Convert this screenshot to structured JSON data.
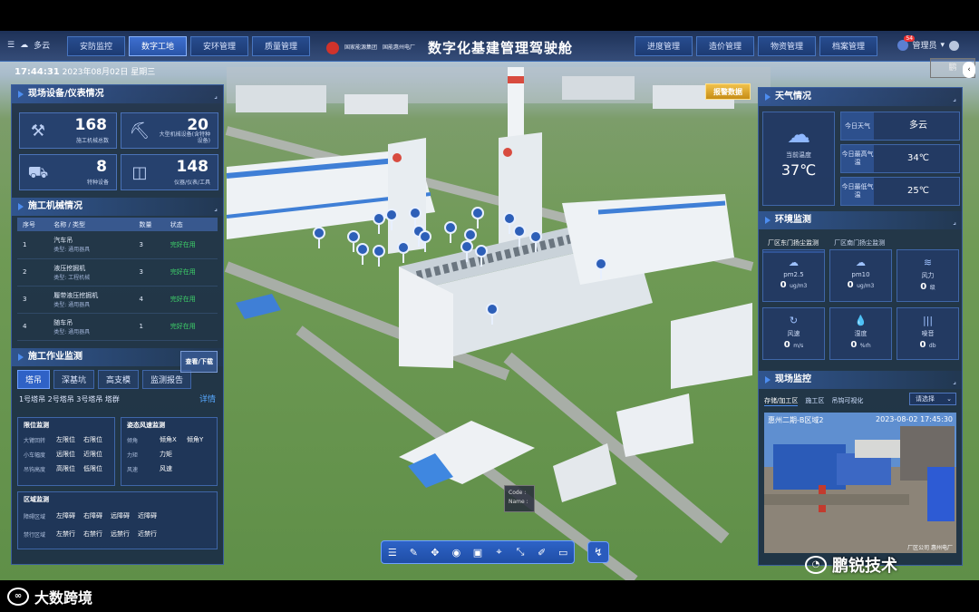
{
  "header": {
    "weather_text": "多云",
    "title": "数字化基建管理驾驶舱",
    "org_line1": "国家能源集团",
    "org_line2": "国能惠州电厂",
    "time": "17:44:31",
    "date": "2023年08月02日 星期三",
    "user": "管理员",
    "notif_count": "54",
    "left_tabs": [
      "安防监控",
      "数字工地",
      "安环管理",
      "质量管理"
    ],
    "right_tabs": [
      "进度管理",
      "造价管理",
      "物资管理",
      "档案管理"
    ],
    "active_tab": "数字工地",
    "side_label": "鹏",
    "side_arrow": "‹"
  },
  "equipment": {
    "title": "现场设备/仪表情况",
    "stats": [
      {
        "value": "168",
        "label": "施工机械总数",
        "icon": "crane-icon"
      },
      {
        "value": "20",
        "label": "大型机械设备(含特种设备)",
        "icon": "excavator-icon"
      },
      {
        "value": "8",
        "label": "特种设备",
        "icon": "truck-icon"
      },
      {
        "value": "148",
        "label": "仪器/仪表/工具",
        "icon": "gauge-icon"
      }
    ]
  },
  "machinery": {
    "title": "施工机械情况",
    "headers": [
      "序号",
      "名称 / 类型",
      "数量",
      "状态"
    ],
    "rows": [
      {
        "no": "1",
        "name": "汽车吊",
        "type": "类型: 通用器具",
        "qty": "3",
        "status": "完好在用"
      },
      {
        "no": "2",
        "name": "液压挖掘机",
        "type": "类型: 工程机械",
        "qty": "3",
        "status": "完好在用"
      },
      {
        "no": "3",
        "name": "履带液压挖掘机",
        "type": "类型: 通用器具",
        "qty": "4",
        "status": "完好在用"
      },
      {
        "no": "4",
        "name": "随车吊",
        "type": "类型: 通用器具",
        "qty": "1",
        "status": "完好在用"
      }
    ]
  },
  "monitor": {
    "title": "施工作业监测",
    "view_btn": "查看/下载",
    "tabs": [
      "塔吊",
      "深基坑",
      "高支模",
      "监测报告"
    ],
    "crane_list": "1号塔吊  2号塔吊  3号塔吊    塔群",
    "detail": "详情",
    "limit": {
      "title": "限位监测",
      "rows": [
        [
          "大臂回转",
          "左限位",
          "右限位"
        ],
        [
          "小车幅度",
          "远限位",
          "近限位"
        ],
        [
          "吊钩高度",
          "高限位",
          "低限位"
        ]
      ]
    },
    "posture": {
      "title": "姿态风速监测",
      "rows": [
        [
          "倾角",
          "倾角X",
          "倾角Y"
        ],
        [
          "力矩",
          "力矩",
          ""
        ],
        [
          "风速",
          "风速",
          ""
        ]
      ]
    },
    "zone": {
      "title": "区域监测",
      "rows": [
        [
          "障碍区域",
          "左障碍",
          "右障碍",
          "远障碍",
          "近障碍"
        ],
        [
          "禁行区域",
          "左禁行",
          "右禁行",
          "远禁行",
          "近禁行"
        ]
      ]
    }
  },
  "weather": {
    "title": "天气情况",
    "current_label": "当前温度",
    "current_temp": "37℃",
    "rows": [
      {
        "k": "今日天气",
        "v": "多云"
      },
      {
        "k": "今日最高气温",
        "v": "34℃"
      },
      {
        "k": "今日最低气温",
        "v": "25℃"
      }
    ]
  },
  "env": {
    "title": "环境监测",
    "tabs": [
      "厂区东门扬尘监测",
      "厂区南门扬尘监测"
    ],
    "cells": [
      {
        "k": "pm2.5",
        "v": "0",
        "u": "ug/m3",
        "icon": "pm25-icon"
      },
      {
        "k": "pm10",
        "v": "0",
        "u": "ug/m3",
        "icon": "pm10-icon"
      },
      {
        "k": "风力",
        "v": "0",
        "u": "级",
        "icon": "wind-icon"
      },
      {
        "k": "风速",
        "v": "0",
        "u": "m/s",
        "icon": "wind-speed-icon"
      },
      {
        "k": "湿度",
        "v": "0",
        "u": "%rh",
        "icon": "humidity-icon"
      },
      {
        "k": "噪音",
        "v": "0",
        "u": "db",
        "icon": "noise-icon"
      }
    ]
  },
  "camera": {
    "title": "现场监控",
    "tabs": [
      "存储/加工区",
      "施工区",
      "吊钩可视化"
    ],
    "select": "请选择",
    "location": "惠州二期-B区域2",
    "timestamp": "2023-08-02  17:45:30",
    "footer": "厂区公司  惠州电厂"
  },
  "scene": {
    "alarm": "报警数据",
    "code_tip_1": "Code :",
    "code_tip_2": "Name :"
  },
  "toolbar": {
    "icons": [
      "layers-icon",
      "edit-icon",
      "move-icon",
      "view-icon",
      "frame-icon",
      "target-icon",
      "measure-icon",
      "draw-icon",
      "screen-icon"
    ],
    "extra": "route-icon"
  },
  "watermarks": {
    "left": "大数跨境",
    "right": "鹏锐技术"
  }
}
